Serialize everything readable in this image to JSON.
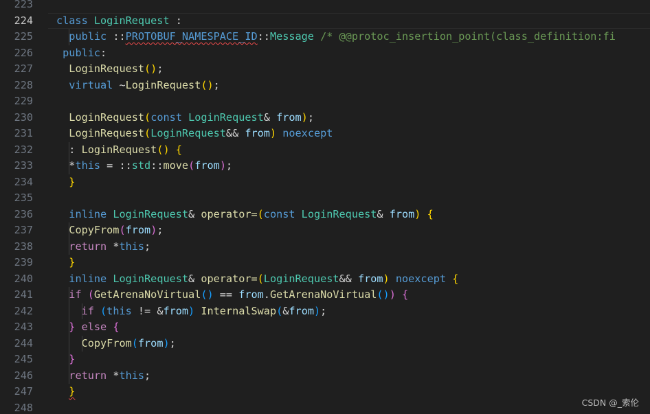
{
  "theme": {
    "background": "#1f1f1f",
    "keyword": "#569cd6",
    "control": "#c586c0",
    "type": "#4ec9b0",
    "function": "#dcdcaa",
    "variable": "#9cdcfe",
    "comment": "#6a9955",
    "plain": "#d4d4d4",
    "bracket_gold": "#ffd700",
    "bracket_pink": "#da70d6",
    "bracket_blue": "#179fff",
    "line_number": "#6e7681",
    "active_line_number": "#c6c6c6"
  },
  "editor": {
    "active_line": 224,
    "lines": [
      {
        "n": "223",
        "indent": 0,
        "tokens": []
      },
      {
        "n": "224",
        "indent": 0,
        "tokens": [
          [
            "class ",
            "keyword"
          ],
          [
            "LoginRequest",
            "type"
          ],
          [
            " :",
            "plain"
          ]
        ]
      },
      {
        "n": "225",
        "indent": 1,
        "tokens": [
          [
            "public ",
            "keyword"
          ],
          [
            "::",
            "plain"
          ],
          [
            "PROTOBUF_NAMESPACE_ID",
            "keyword",
            "squig"
          ],
          [
            "::",
            "plain"
          ],
          [
            "Message",
            "type"
          ],
          [
            " ",
            "plain"
          ],
          [
            "/* @@protoc_insertion_point(class_definition:fi",
            "comment"
          ]
        ]
      },
      {
        "n": "226",
        "indent": 0,
        "prefix": " ",
        "tokens": [
          [
            "public",
            "keyword"
          ],
          [
            ":",
            "plain"
          ]
        ]
      },
      {
        "n": "227",
        "indent": 0,
        "prefix": "  ",
        "tokens": [
          [
            "LoginRequest",
            "function"
          ],
          [
            "()",
            "bracket_gold"
          ],
          [
            ";",
            "plain"
          ]
        ]
      },
      {
        "n": "228",
        "indent": 0,
        "prefix": "  ",
        "tokens": [
          [
            "virtual ",
            "keyword"
          ],
          [
            "~",
            "plain"
          ],
          [
            "LoginRequest",
            "function"
          ],
          [
            "()",
            "bracket_gold"
          ],
          [
            ";",
            "plain"
          ]
        ]
      },
      {
        "n": "229",
        "indent": 0,
        "tokens": []
      },
      {
        "n": "230",
        "indent": 0,
        "prefix": "  ",
        "tokens": [
          [
            "LoginRequest",
            "function"
          ],
          [
            "(",
            "bracket_gold"
          ],
          [
            "const ",
            "keyword"
          ],
          [
            "LoginRequest",
            "type"
          ],
          [
            "& ",
            "plain"
          ],
          [
            "from",
            "variable"
          ],
          [
            ")",
            "bracket_gold"
          ],
          [
            ";",
            "plain"
          ]
        ]
      },
      {
        "n": "231",
        "indent": 0,
        "prefix": "  ",
        "tokens": [
          [
            "LoginRequest",
            "function"
          ],
          [
            "(",
            "bracket_gold"
          ],
          [
            "LoginRequest",
            "type"
          ],
          [
            "&& ",
            "plain"
          ],
          [
            "from",
            "variable"
          ],
          [
            ")",
            "bracket_gold"
          ],
          [
            " ",
            "plain"
          ],
          [
            "noexcept",
            "keyword"
          ]
        ]
      },
      {
        "n": "232",
        "indent": 1,
        "tokens": [
          [
            ": ",
            "plain"
          ],
          [
            "LoginRequest",
            "function"
          ],
          [
            "()",
            "bracket_gold"
          ],
          [
            " ",
            "plain"
          ],
          [
            "{",
            "bracket_gold"
          ]
        ]
      },
      {
        "n": "233",
        "indent": 1,
        "tokens": [
          [
            "*",
            "plain"
          ],
          [
            "this",
            "keyword"
          ],
          [
            " = ",
            "plain"
          ],
          [
            "::",
            "plain"
          ],
          [
            "std",
            "type"
          ],
          [
            "::",
            "plain"
          ],
          [
            "move",
            "function"
          ],
          [
            "(",
            "bracket_pink"
          ],
          [
            "from",
            "variable"
          ],
          [
            ")",
            "bracket_pink"
          ],
          [
            ";",
            "plain"
          ]
        ]
      },
      {
        "n": "234",
        "indent": 0,
        "prefix": "  ",
        "tokens": [
          [
            "}",
            "bracket_gold"
          ]
        ]
      },
      {
        "n": "235",
        "indent": 0,
        "tokens": []
      },
      {
        "n": "236",
        "indent": 0,
        "prefix": "  ",
        "tokens": [
          [
            "inline ",
            "keyword"
          ],
          [
            "LoginRequest",
            "type"
          ],
          [
            "& ",
            "plain"
          ],
          [
            "operator=",
            "function"
          ],
          [
            "(",
            "bracket_gold"
          ],
          [
            "const ",
            "keyword"
          ],
          [
            "LoginRequest",
            "type"
          ],
          [
            "& ",
            "plain"
          ],
          [
            "from",
            "variable"
          ],
          [
            ")",
            "bracket_gold"
          ],
          [
            " ",
            "plain"
          ],
          [
            "{",
            "bracket_gold"
          ]
        ]
      },
      {
        "n": "237",
        "indent": 1,
        "tokens": [
          [
            "CopyFrom",
            "function"
          ],
          [
            "(",
            "bracket_pink"
          ],
          [
            "from",
            "variable"
          ],
          [
            ")",
            "bracket_pink"
          ],
          [
            ";",
            "plain"
          ]
        ]
      },
      {
        "n": "238",
        "indent": 1,
        "tokens": [
          [
            "return ",
            "control"
          ],
          [
            "*",
            "plain"
          ],
          [
            "this",
            "keyword"
          ],
          [
            ";",
            "plain"
          ]
        ]
      },
      {
        "n": "239",
        "indent": 0,
        "prefix": "  ",
        "tokens": [
          [
            "}",
            "bracket_gold"
          ]
        ]
      },
      {
        "n": "240",
        "indent": 0,
        "prefix": "  ",
        "tokens": [
          [
            "inline ",
            "keyword"
          ],
          [
            "LoginRequest",
            "type"
          ],
          [
            "& ",
            "plain"
          ],
          [
            "operator=",
            "function"
          ],
          [
            "(",
            "bracket_gold"
          ],
          [
            "LoginRequest",
            "type"
          ],
          [
            "&& ",
            "plain"
          ],
          [
            "from",
            "variable"
          ],
          [
            ")",
            "bracket_gold"
          ],
          [
            " ",
            "plain"
          ],
          [
            "noexcept",
            "keyword"
          ],
          [
            " ",
            "plain"
          ],
          [
            "{",
            "bracket_gold"
          ]
        ]
      },
      {
        "n": "241",
        "indent": 1,
        "tokens": [
          [
            "if ",
            "control"
          ],
          [
            "(",
            "bracket_pink"
          ],
          [
            "GetArenaNoVirtual",
            "function"
          ],
          [
            "()",
            "bracket_blue"
          ],
          [
            " == ",
            "plain"
          ],
          [
            "from",
            "variable"
          ],
          [
            ".",
            "plain"
          ],
          [
            "GetArenaNoVirtual",
            "function"
          ],
          [
            "()",
            "bracket_blue"
          ],
          [
            ")",
            "bracket_pink"
          ],
          [
            " ",
            "plain"
          ],
          [
            "{",
            "bracket_pink"
          ]
        ]
      },
      {
        "n": "242",
        "indent": 2,
        "tokens": [
          [
            "if ",
            "control"
          ],
          [
            "(",
            "bracket_blue"
          ],
          [
            "this",
            "keyword"
          ],
          [
            " != &",
            "plain"
          ],
          [
            "from",
            "variable"
          ],
          [
            ")",
            "bracket_blue"
          ],
          [
            " ",
            "plain"
          ],
          [
            "InternalSwap",
            "function"
          ],
          [
            "(",
            "bracket_blue"
          ],
          [
            "&",
            "plain"
          ],
          [
            "from",
            "variable"
          ],
          [
            ")",
            "bracket_blue"
          ],
          [
            ";",
            "plain"
          ]
        ]
      },
      {
        "n": "243",
        "indent": 1,
        "tokens": [
          [
            "}",
            "bracket_pink"
          ],
          [
            " ",
            "plain"
          ],
          [
            "else ",
            "control"
          ],
          [
            "{",
            "bracket_pink"
          ]
        ]
      },
      {
        "n": "244",
        "indent": 2,
        "tokens": [
          [
            "CopyFrom",
            "function"
          ],
          [
            "(",
            "bracket_blue"
          ],
          [
            "from",
            "variable"
          ],
          [
            ")",
            "bracket_blue"
          ],
          [
            ";",
            "plain"
          ]
        ]
      },
      {
        "n": "245",
        "indent": 1,
        "tokens": [
          [
            "}",
            "bracket_pink"
          ]
        ]
      },
      {
        "n": "246",
        "indent": 1,
        "tokens": [
          [
            "return ",
            "control"
          ],
          [
            "*",
            "plain"
          ],
          [
            "this",
            "keyword"
          ],
          [
            ";",
            "plain"
          ]
        ]
      },
      {
        "n": "247",
        "indent": 0,
        "prefix": "  ",
        "tokens": [
          [
            "}",
            "bracket_gold",
            "squig"
          ]
        ]
      },
      {
        "n": "248",
        "indent": 0,
        "tokens": []
      }
    ]
  },
  "watermark": "CSDN @_索伦"
}
